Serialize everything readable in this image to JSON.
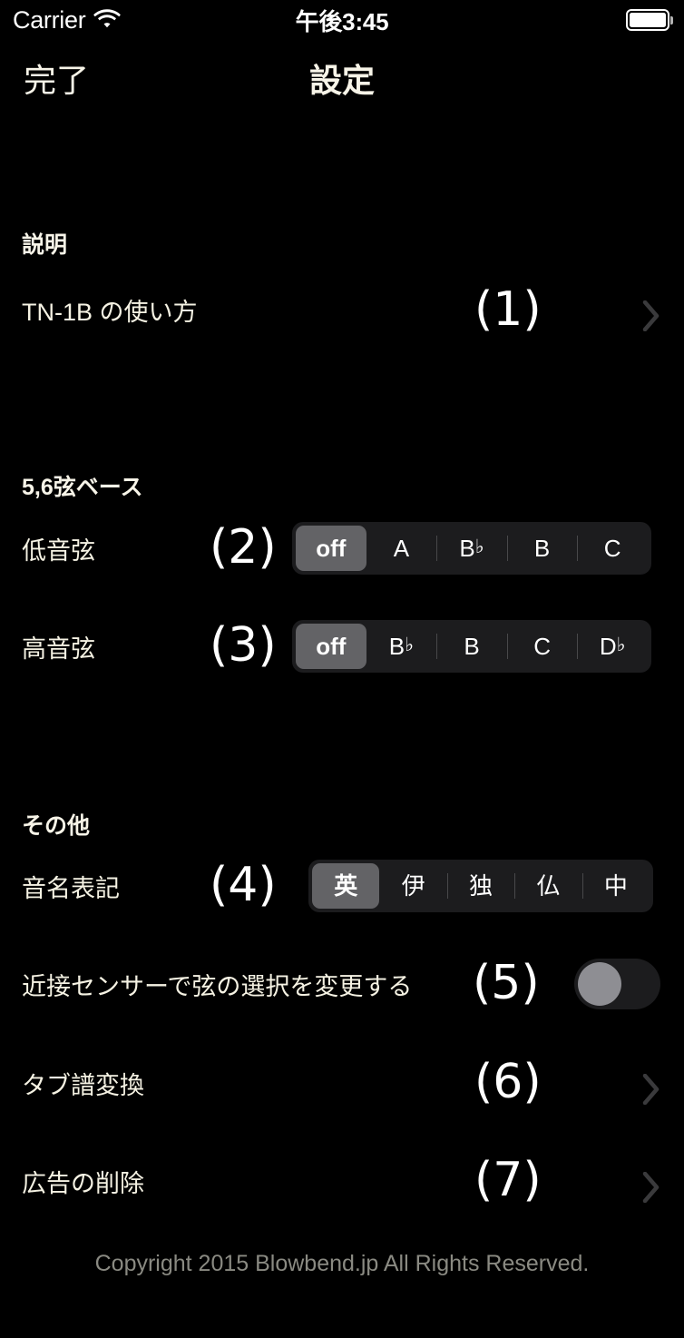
{
  "status_bar": {
    "carrier": "Carrier",
    "wifi_icon": "wifi-icon",
    "time": "午後3:45",
    "battery_icon": "battery-full-icon"
  },
  "nav": {
    "done_label": "完了",
    "title": "設定"
  },
  "sections": [
    {
      "header": "説明"
    },
    {
      "header": "5,6弦ベース"
    },
    {
      "header": "その他"
    }
  ],
  "rows": {
    "howto": {
      "label": "TN-1B の使い方",
      "annotation": "(1)",
      "accessory": "chevron-right-icon"
    },
    "low_string": {
      "label": "低音弦",
      "annotation": "(2)",
      "options": [
        "off",
        "A",
        "B♭",
        "B",
        "C"
      ],
      "selected_index": 0
    },
    "high_string": {
      "label": "高音弦",
      "annotation": "(3)",
      "options": [
        "off",
        "B♭",
        "B",
        "C",
        "D♭"
      ],
      "selected_index": 0
    },
    "note_names": {
      "label": "音名表記",
      "annotation": "(4)",
      "options": [
        "英",
        "伊",
        "独",
        "仏",
        "中"
      ],
      "selected_index": 0
    },
    "proximity": {
      "label": "近接センサーで弦の選択を変更する",
      "annotation": "(5)",
      "toggle_state": "off"
    },
    "tab_convert": {
      "label": "タブ譜変換",
      "annotation": "(6)",
      "accessory": "chevron-right-icon"
    },
    "remove_ads": {
      "label": "広告の削除",
      "annotation": "(7)",
      "accessory": "chevron-right-icon"
    }
  },
  "footer": {
    "copyright": "Copyright 2015 Blowbend.jp All Rights Reserved."
  },
  "colors": {
    "background": "#000000",
    "text": "#f5f2e3",
    "segmented_track": "#1c1c1e",
    "segmented_selected": "#636366",
    "switch_knob": "#8e8e93",
    "chevron": "#3a3a3c",
    "footer_text": "#8a8a82"
  }
}
